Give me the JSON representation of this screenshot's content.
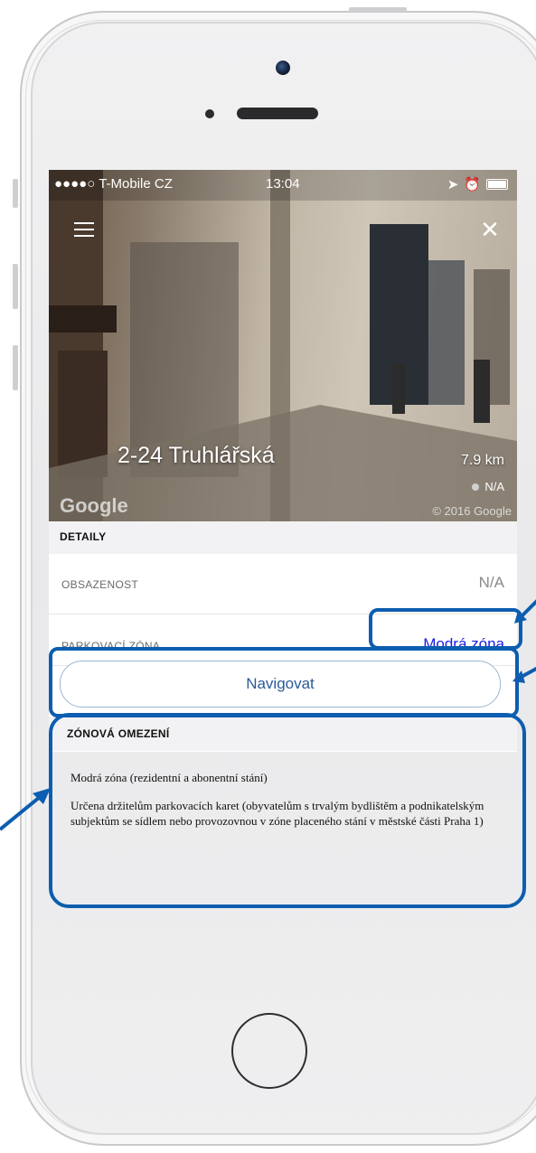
{
  "status_bar": {
    "carrier": "●●●●○ T-Mobile CZ",
    "time": "13:04"
  },
  "header": {
    "menu_icon": "hamburger-icon",
    "close_icon": "close-icon",
    "street": "2-24 Truhlářská",
    "distance": "7.9 km",
    "occupancy_mini": "N/A",
    "map_provider": "Google",
    "copyright": "© 2016 Google"
  },
  "details": {
    "section_title": "DETAILY",
    "rows": [
      {
        "label": "OBSAZENOST",
        "value": "N/A"
      },
      {
        "label": "PARKOVACÍ ZÓNA",
        "value": "Modrá zóna"
      }
    ],
    "navigate_label": "Navigovat"
  },
  "zone_restrictions": {
    "section_title": "ZÓNOVÁ OMEZENÍ",
    "line1": "Modrá zóna (rezidentní a abonentní stání)",
    "line2": "Určena držitelům parkovacích karet (obyvatelům s trvalým bydlištěm a podnikatelským subjektům se sídlem nebo provozovnou v zóne placeného stání v městské části Praha 1)"
  },
  "colors": {
    "accent_link": "#1a1ee0",
    "annotation": "#0d5db0"
  }
}
